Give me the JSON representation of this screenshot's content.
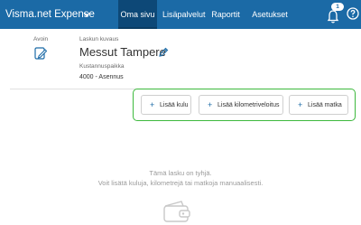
{
  "app": {
    "title": "Visma.net Expense"
  },
  "nav": {
    "tabs": [
      {
        "label": "Oma sivu",
        "active": true
      },
      {
        "label": "Lisäpalvelut",
        "active": false
      },
      {
        "label": "Raportit",
        "active": false
      },
      {
        "label": "Asetukset",
        "active": false
      }
    ],
    "notification_count": "1"
  },
  "invoice": {
    "status_label": "Avoin",
    "description_label": "Laskun kuvaus",
    "description": "Messut Tampere",
    "cost_center_label": "Kustannuspaikka",
    "cost_center": "4000 - Asennus"
  },
  "actions": {
    "add_expense": "Lisää kulu",
    "add_mileage": "Lisää kilometriveloitus",
    "add_travel": "Lisää matka"
  },
  "empty_state": {
    "line1": "Tämä lasku on tyhjä.",
    "line2": "Voit lisätä kuluja, kilometrejä tai matkoja manuaalisesti."
  },
  "colors": {
    "header": "#1b6aa6",
    "active_tab": "#0d4877",
    "highlight_border": "#3db93d",
    "accent": "#1b6aa6"
  },
  "icons": [
    "chevron-down-icon",
    "bell-icon",
    "help-icon",
    "document-edit-icon",
    "pencil-icon",
    "plus-icon",
    "wallet-icon"
  ]
}
